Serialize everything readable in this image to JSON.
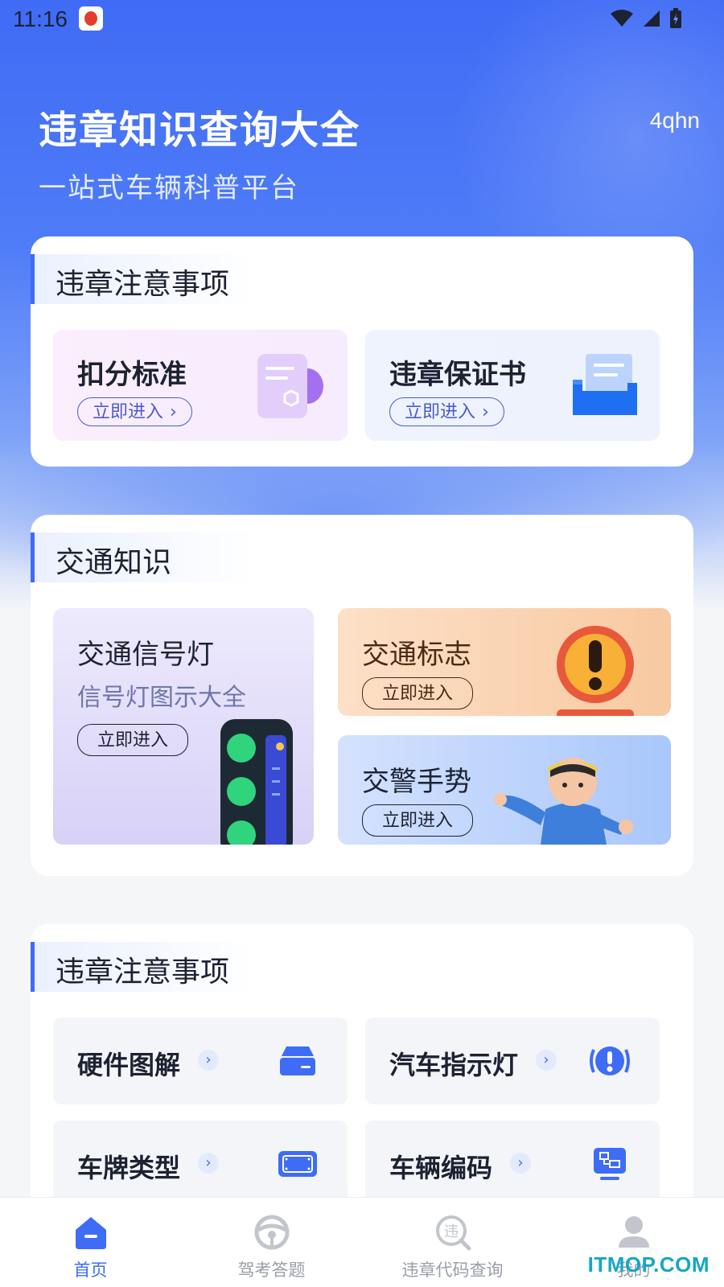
{
  "status_bar": {
    "time": "11:16"
  },
  "header": {
    "title": "违章知识查询大全",
    "subtitle": "一站式车辆科普平台",
    "corner_code": "4qhn"
  },
  "section1": {
    "title": "违章注意事项",
    "tiles": [
      {
        "label": "扣分标准",
        "action": "立即进入",
        "icon": "document-icon"
      },
      {
        "label": "违章保证书",
        "action": "立即进入",
        "icon": "document-tray-icon"
      }
    ]
  },
  "section2": {
    "title": "交通知识",
    "tiles": [
      {
        "label": "交通信号灯",
        "desc": "信号灯图示大全",
        "action": "立即进入",
        "icon": "traffic-light-icon"
      },
      {
        "label": "交通标志",
        "action": "立即进入",
        "icon": "warning-sign-icon"
      },
      {
        "label": "交警手势",
        "action": "立即进入",
        "icon": "police-figure-icon"
      }
    ]
  },
  "section3": {
    "title": "违章注意事项",
    "tiles": [
      {
        "label": "硬件图解",
        "icon": "hardware-icon"
      },
      {
        "label": "汽车指示灯",
        "icon": "alert-light-icon"
      },
      {
        "label": "车牌类型",
        "icon": "license-plate-icon"
      },
      {
        "label": "车辆编码",
        "icon": "code-icon"
      }
    ]
  },
  "bottom_nav": [
    {
      "label": "首页",
      "icon": "home-icon",
      "active": true
    },
    {
      "label": "驾考答题",
      "icon": "steering-wheel-icon",
      "active": false
    },
    {
      "label": "违章代码查询",
      "icon": "violation-search-icon",
      "active": false
    },
    {
      "label": "我的",
      "icon": "user-icon",
      "active": false
    }
  ],
  "watermark": "ITMOP.COM",
  "colors": {
    "primary": "#3e6cf6",
    "text_dark": "#1d2233",
    "header_gradient_start": "#3f6bf6"
  }
}
